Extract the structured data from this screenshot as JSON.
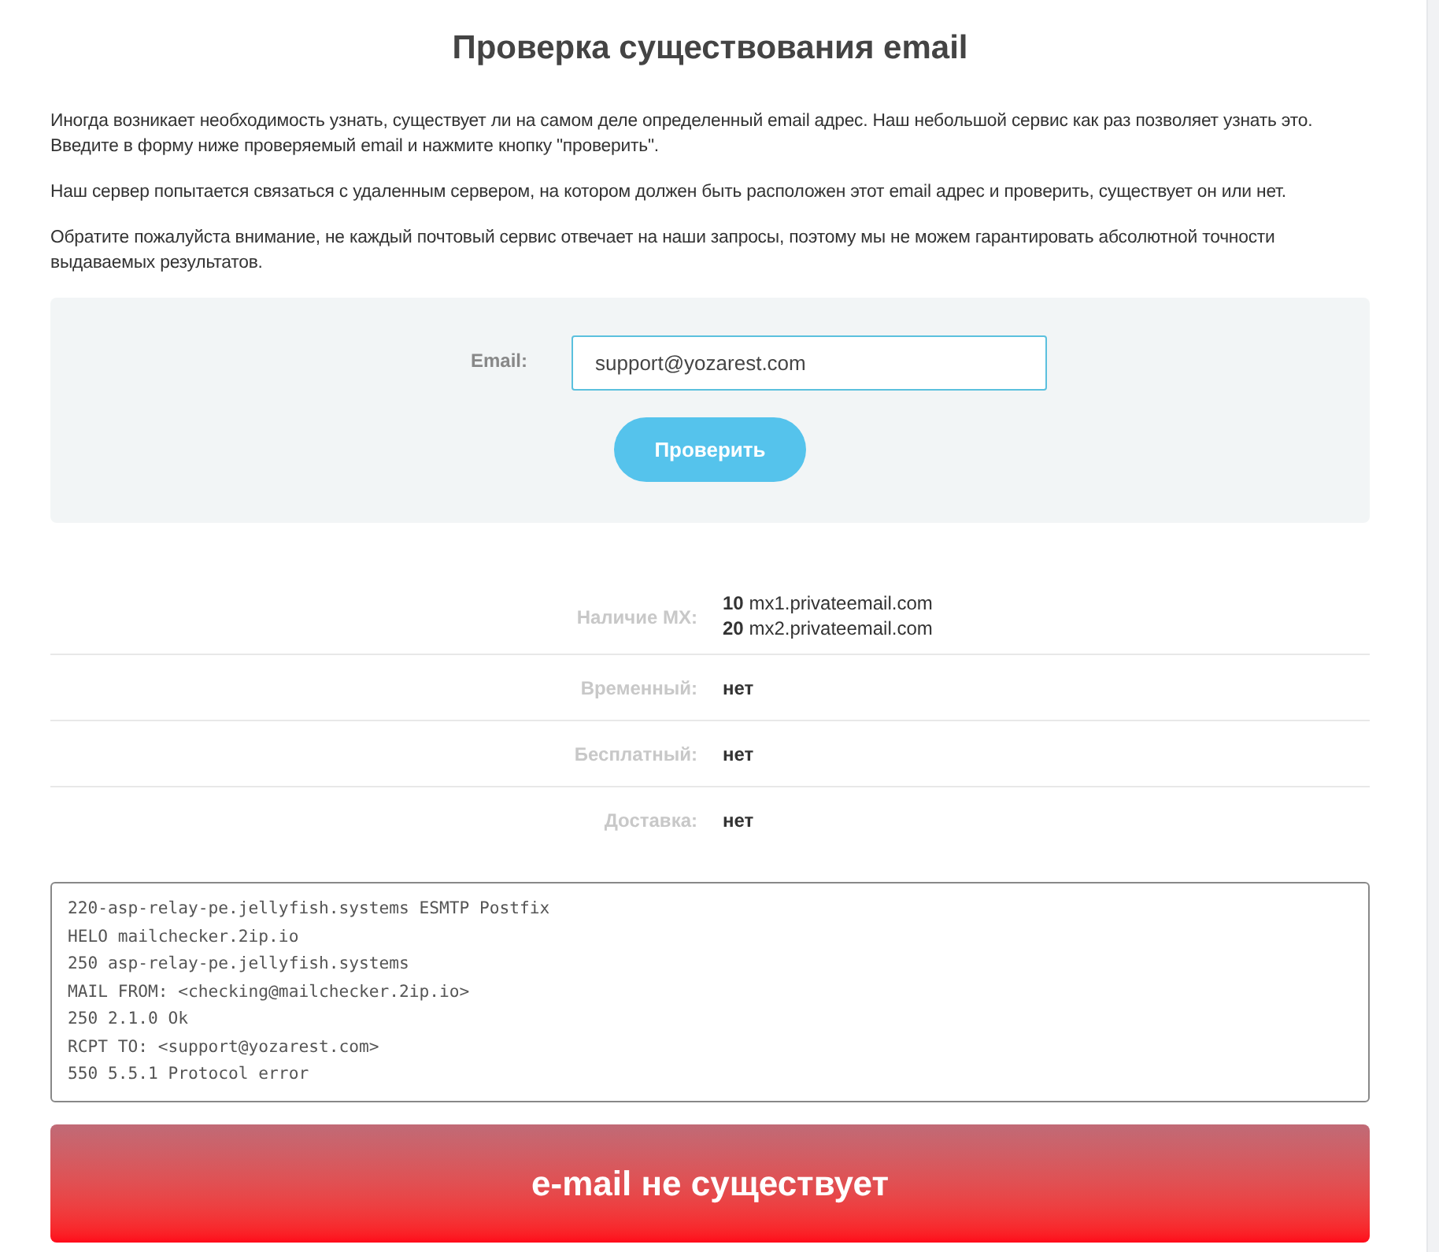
{
  "title": "Проверка существования email",
  "intro_paragraphs": [
    "Иногда возникает необходимость узнать, существует ли на самом деле определенный email адрес. Наш небольшой сервис как раз позволяет узнать это. Введите в форму ниже проверяемый email и нажмите кнопку \"проверить\".",
    "Наш сервер попытается связаться с удаленным сервером, на котором должен быть расположен этот email адрес и проверить, существует он или нет.",
    "Обратите пожалуйста внимание, не каждый почтовый сервис отвечает на наши запросы, поэтому мы не можем гарантировать абсолютной точности выдаваемых результатов."
  ],
  "form": {
    "label": "Email:",
    "value": "support@yozarest.com",
    "button": "Проверить"
  },
  "results": [
    {
      "label": "Наличие MX:",
      "values": [
        "**10** mx1.privateemail.com",
        "**20** mx2.privateemail.com"
      ]
    },
    {
      "label": "Временный:",
      "values": [
        "нет"
      ]
    },
    {
      "label": "Бесплатный:",
      "values": [
        "нет"
      ]
    },
    {
      "label": "Доставка:",
      "values": [
        "нет"
      ]
    }
  ],
  "log_lines": [
    "220-asp-relay-pe.jellyfish.systems ESMTP Postfix",
    "HELO mailchecker.2ip.io",
    "250 asp-relay-pe.jellyfish.systems",
    "MAIL FROM: <checking@mailchecker.2ip.io>",
    "250 2.1.0 Ok",
    "RCPT TO: <support@yozarest.com>",
    "550 5.5.1 Protocol error"
  ],
  "result_banner": {
    "kind": "error",
    "text": "e-mail не существует"
  }
}
